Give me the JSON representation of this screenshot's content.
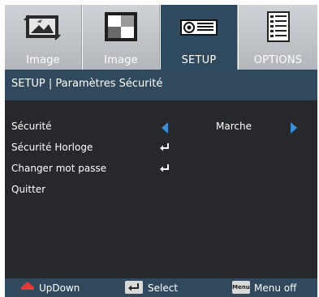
{
  "tabs": [
    {
      "label": "Image",
      "icon": "landscape-picture-icon",
      "active": false
    },
    {
      "label": "Image",
      "icon": "contrast-squares-icon",
      "active": false
    },
    {
      "label": "SETUP",
      "icon": "projector-icon",
      "active": true
    },
    {
      "label": "OPTIONS",
      "icon": "options-list-icon",
      "active": false
    }
  ],
  "header": {
    "title": "SETUP | Paramètres Sécurité"
  },
  "rows": [
    {
      "label": "Sécurité",
      "value": "Marche",
      "control": "selector"
    },
    {
      "label": "Sécurité Horloge",
      "control": "enter"
    },
    {
      "label": "Changer mot passe",
      "control": "enter"
    },
    {
      "label": "Quitter",
      "control": "none"
    }
  ],
  "footer": {
    "updown": "UpDown",
    "select": "Select",
    "menu_key": "Menu",
    "menu": "Menu off"
  },
  "colors": {
    "tab_active": "#2f4a5f",
    "panel": "#27282c",
    "accent_arrow": "#3a8fd8",
    "updown_icon": "#e53935"
  }
}
